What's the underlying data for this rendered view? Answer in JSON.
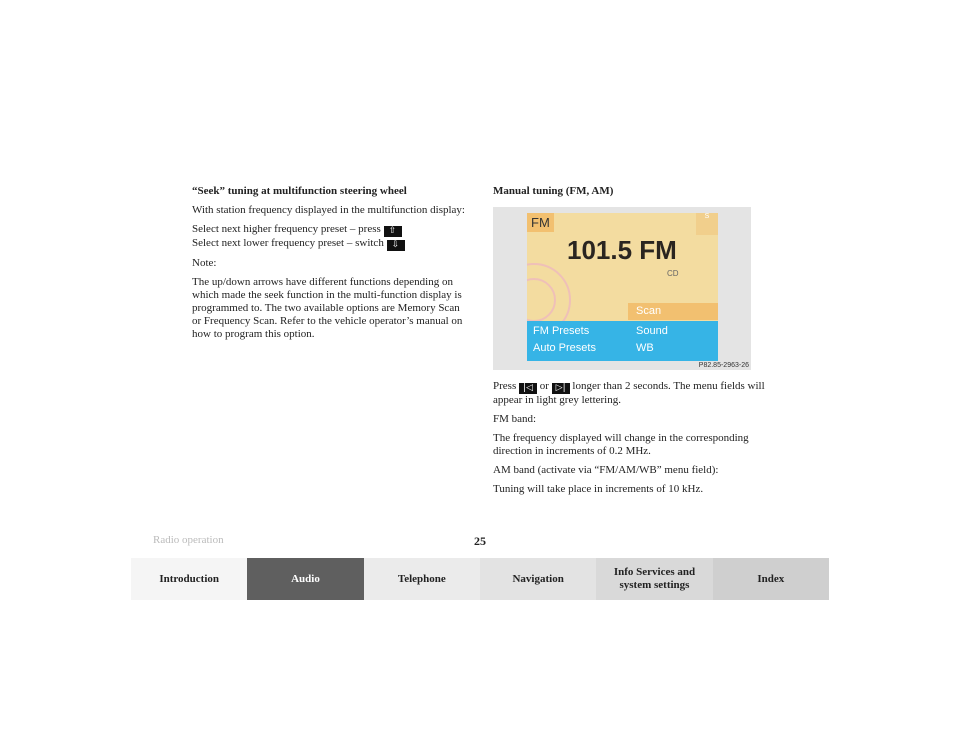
{
  "left": {
    "heading": "“Seek” tuning at multifunction steering wheel",
    "p1": "With station frequency displayed in the multifunction display:",
    "higher": "Select next higher frequency preset – press",
    "lower": "Select next lower frequency preset – switch",
    "note_label": "Note:",
    "note": "The up/down arrows have different functions depending on which made the seek function in the multi-function display is programmed to. The two available options are Memory Scan or Frequency Scan. Refer to the vehicle operator’s manual on how to program this option."
  },
  "right": {
    "heading": "Manual tuning (FM, AM)",
    "press": "Press",
    "or": "or",
    "press_rest": "longer than 2 seconds. The menu fields will appear in light grey lettering.",
    "fm_band": "FM band:",
    "fm_text": "The frequency displayed will change in the corresponding direction in increments of 0.2 MHz.",
    "am_band": "AM band (activate via “FM/AM/WB” menu field):",
    "am_text": "Tuning will take place in increments of 10 kHz."
  },
  "figure": {
    "band": "FM",
    "frequency": "101.5 FM",
    "cd": "CD",
    "scan": "Scan",
    "fm_presets": "FM Presets",
    "sound": "Sound",
    "auto_presets": "Auto Presets",
    "wb": "WB",
    "code": "P82.85-2963-26"
  },
  "footer": {
    "section": "Radio operation",
    "page": "25"
  },
  "nav": [
    {
      "label": "Introduction",
      "bg": "#f5f5f5",
      "color": "#222"
    },
    {
      "label": "Audio",
      "bg": "#5f5f5f",
      "color": "#fff"
    },
    {
      "label": "Telephone",
      "bg": "#ebebeb",
      "color": "#222"
    },
    {
      "label": "Navigation",
      "bg": "#e3e3e3",
      "color": "#222"
    },
    {
      "label": "Info Services and system settings",
      "bg": "#d9d9d9",
      "color": "#222"
    },
    {
      "label": "Index",
      "bg": "#cfcfcf",
      "color": "#222"
    }
  ]
}
